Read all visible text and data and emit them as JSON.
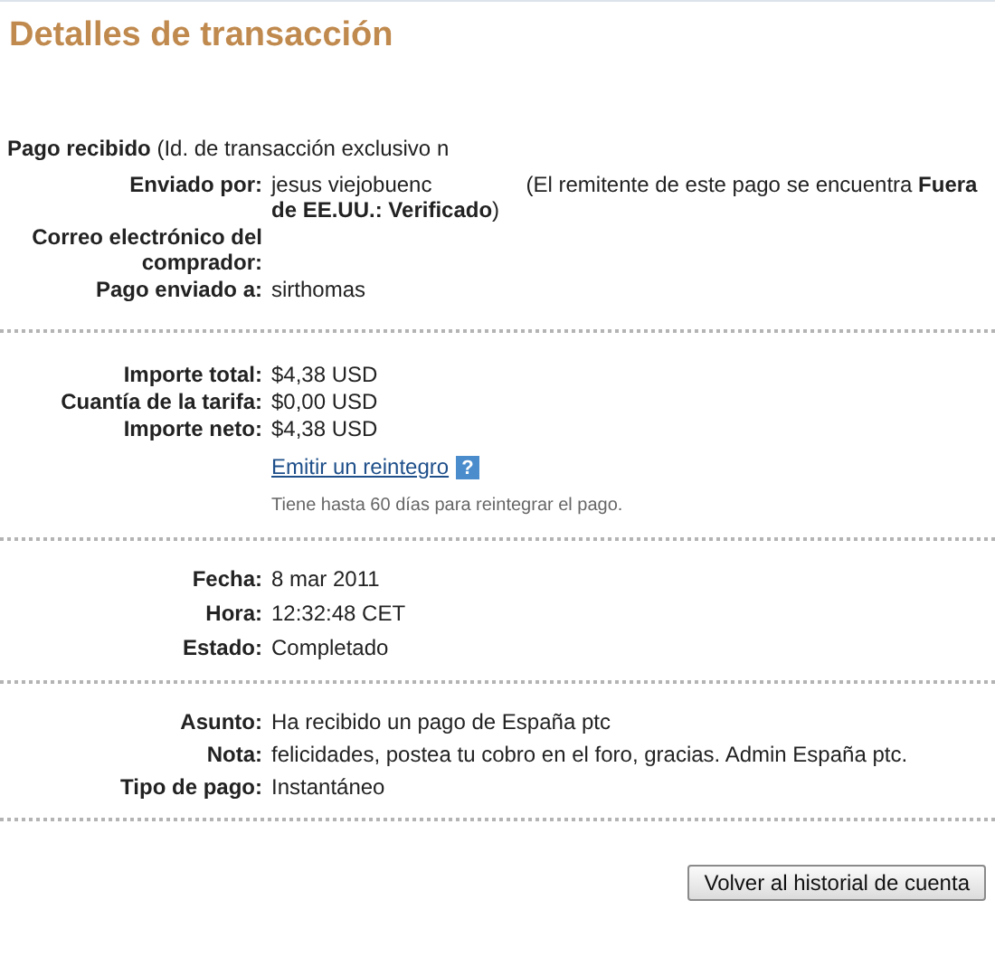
{
  "title": "Detalles de transacción",
  "received": {
    "label": "Pago recibido",
    "text": "(Id. de transacción exclusivo n"
  },
  "parties": [
    {
      "label": "Enviado por:",
      "value": "jesus viejobuenc",
      "note": "(El remitente de este pago se encuentra **Fuera de EE.UU.: Verificado**)"
    },
    {
      "label": "Correo electrónico del comprador:"
    },
    {
      "label": "Pago enviado a:",
      "value": "sirthomas"
    }
  ],
  "amounts": [
    {
      "label": "Importe total:",
      "value": "$4,38 USD"
    },
    {
      "label": "Cuantía de la tarifa:",
      "value": "$0,00 USD"
    },
    {
      "label": "Importe neto:",
      "value": "$4,38 USD"
    }
  ],
  "refund": {
    "link": "Emitir un reintegro",
    "help": "?",
    "hint": "Tiene hasta 60 días para reintegrar el pago."
  },
  "timing": [
    {
      "label": "Fecha:",
      "value": "8 mar 2011"
    },
    {
      "label": "Hora:",
      "value": "12:32:48 CET"
    },
    {
      "label": "Estado:",
      "value": "Completado"
    }
  ],
  "details": [
    {
      "label": "Asunto:",
      "value": "Ha recibido un pago de España ptc"
    },
    {
      "label": "Nota:",
      "value": "felicidades, postea tu cobro en el foro, gracias. Admin España ptc."
    },
    {
      "label": "Tipo de pago:",
      "value": "Instantáneo"
    }
  ],
  "button": "Volver al historial de cuenta"
}
